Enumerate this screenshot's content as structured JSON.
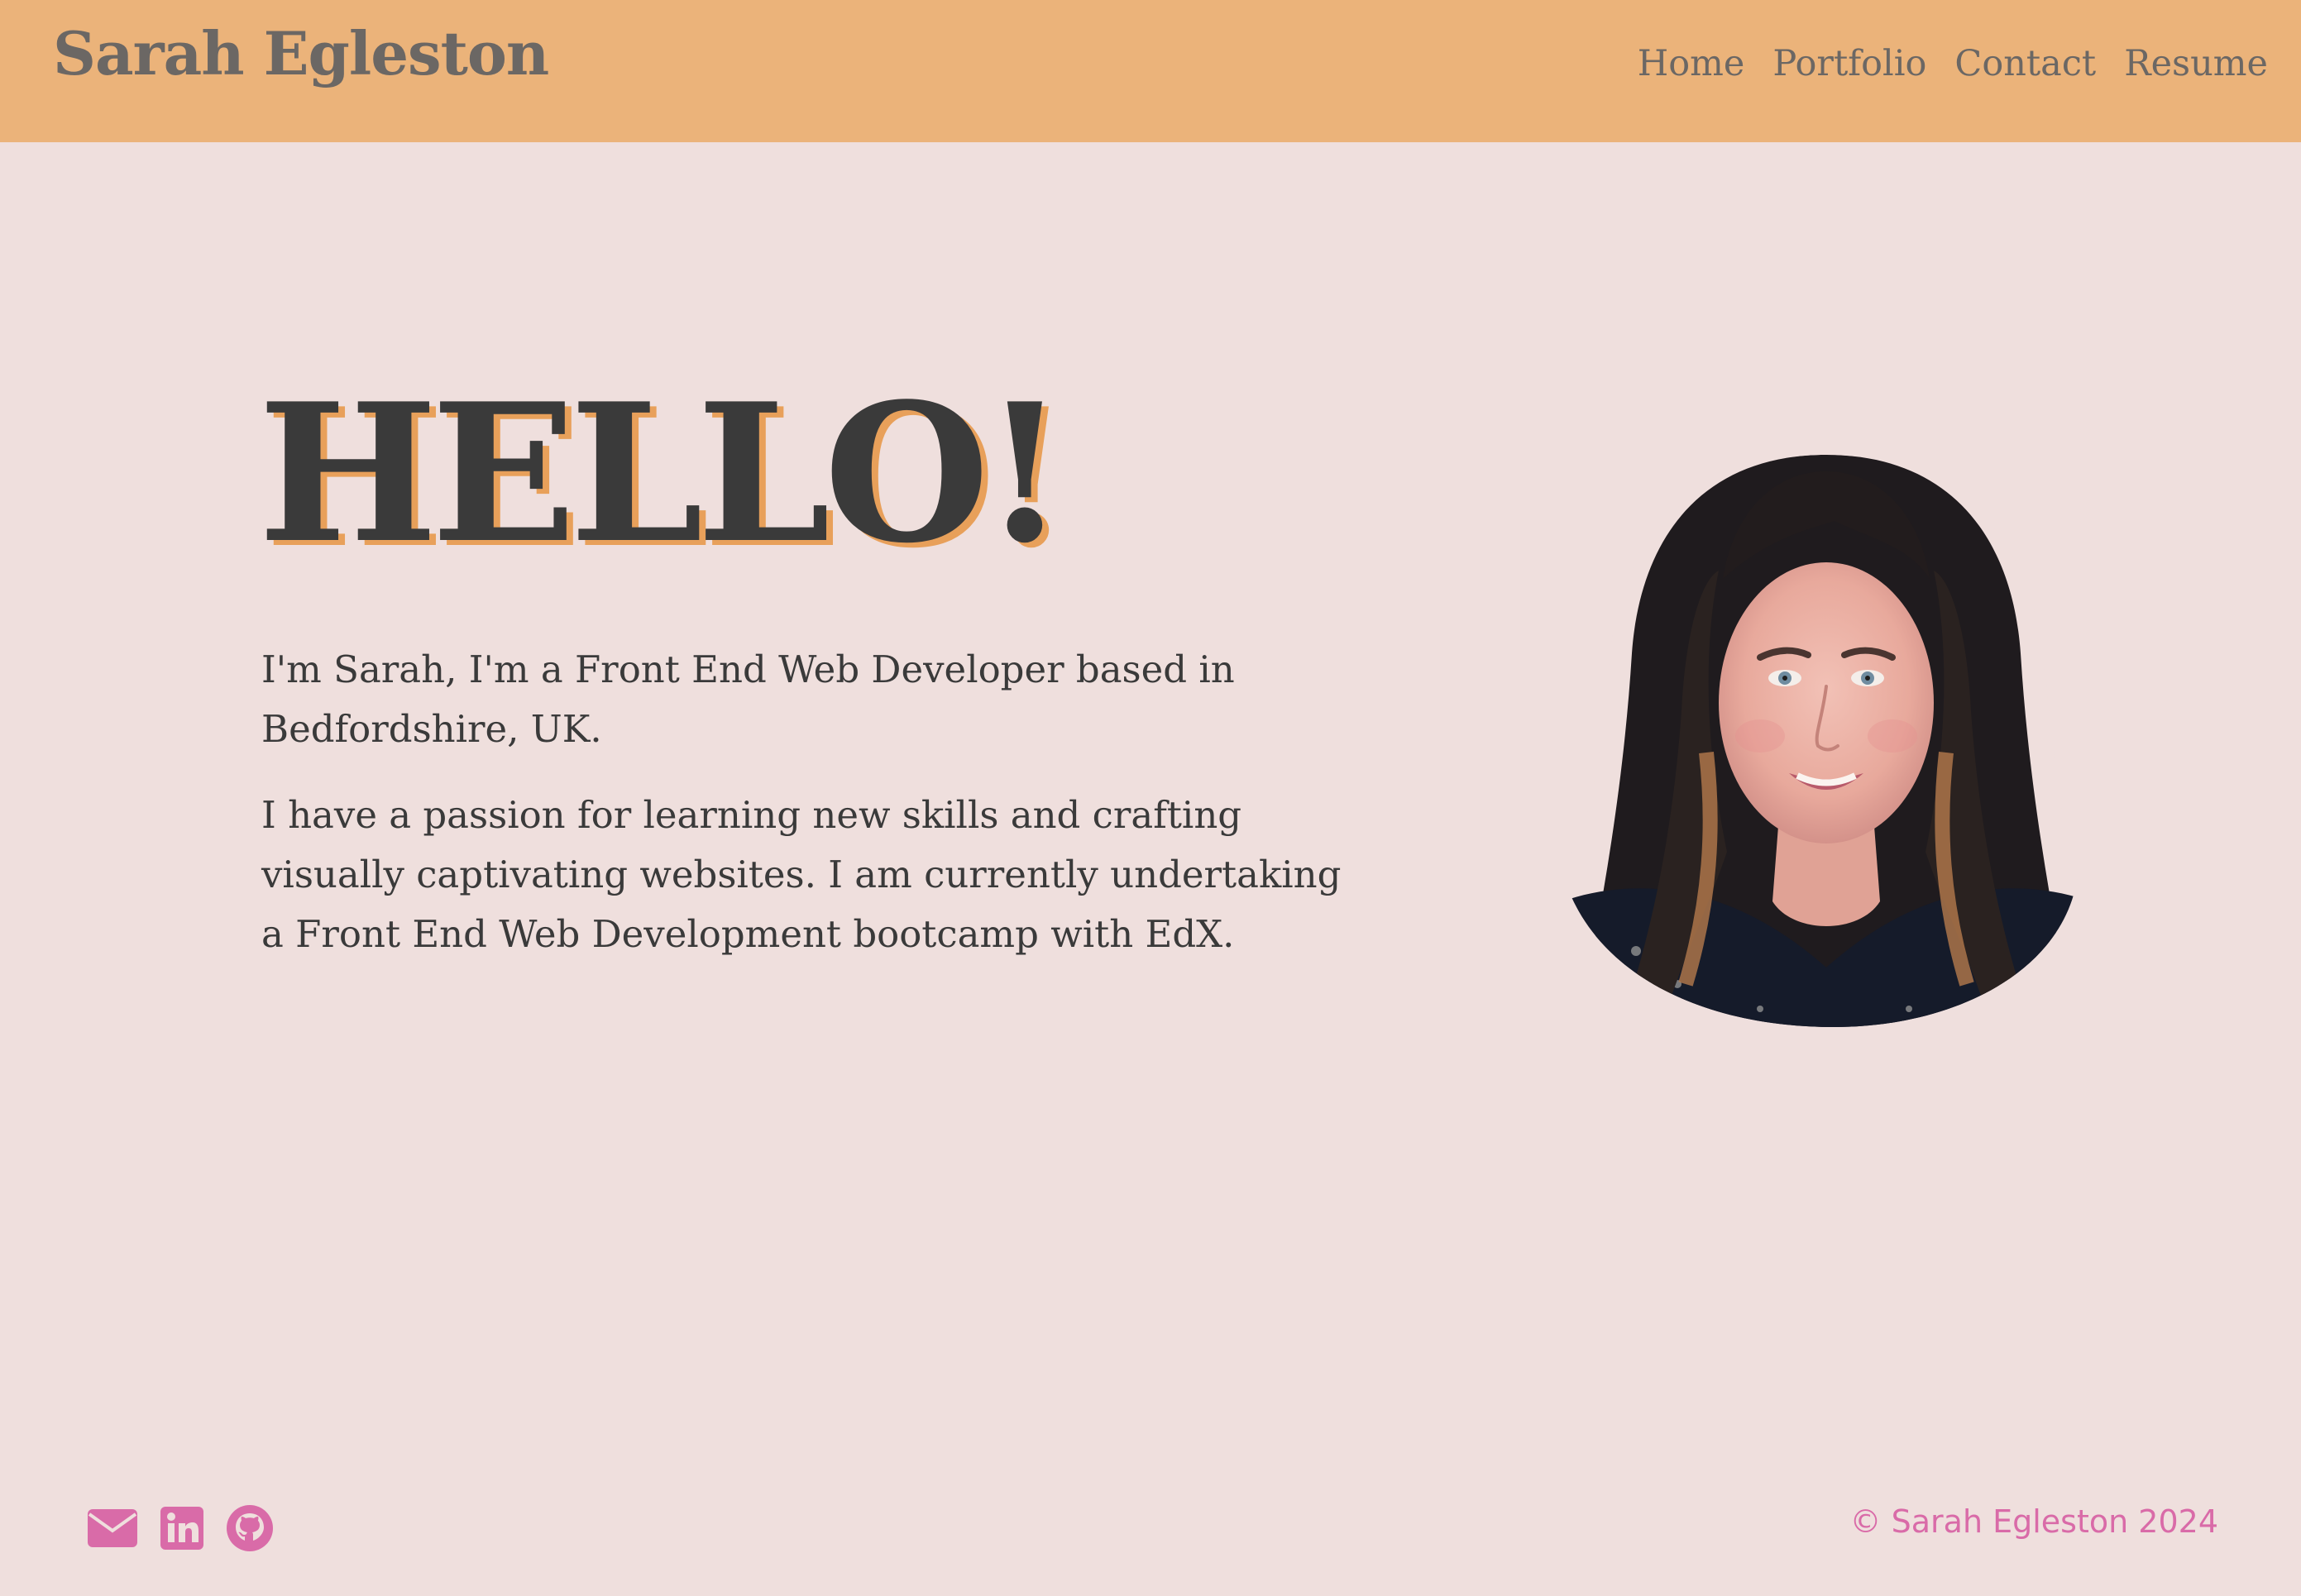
{
  "header": {
    "brand": "Sarah Egleston",
    "nav": [
      {
        "label": "Home"
      },
      {
        "label": "Portfolio"
      },
      {
        "label": "Contact"
      },
      {
        "label": "Resume"
      }
    ]
  },
  "hero": {
    "heading": "HELLO!",
    "paragraph_1": "I'm Sarah, I'm a Front End Web Developer based in Bedfordshire, UK.",
    "paragraph_2": "I have a passion for learning new skills and crafting visually captivating websites. I am currently undertaking a Front End Web Development bootcamp with EdX."
  },
  "footer": {
    "icons": [
      "envelope-icon",
      "linkedin-icon",
      "github-icon"
    ],
    "copyright": "© Sarah Egleston 2024"
  },
  "colors": {
    "header_bg": "#ebb37a",
    "page_bg": "#efdfdd",
    "heading_shadow": "#e8a05a",
    "accent_pink": "#d96ba8"
  }
}
